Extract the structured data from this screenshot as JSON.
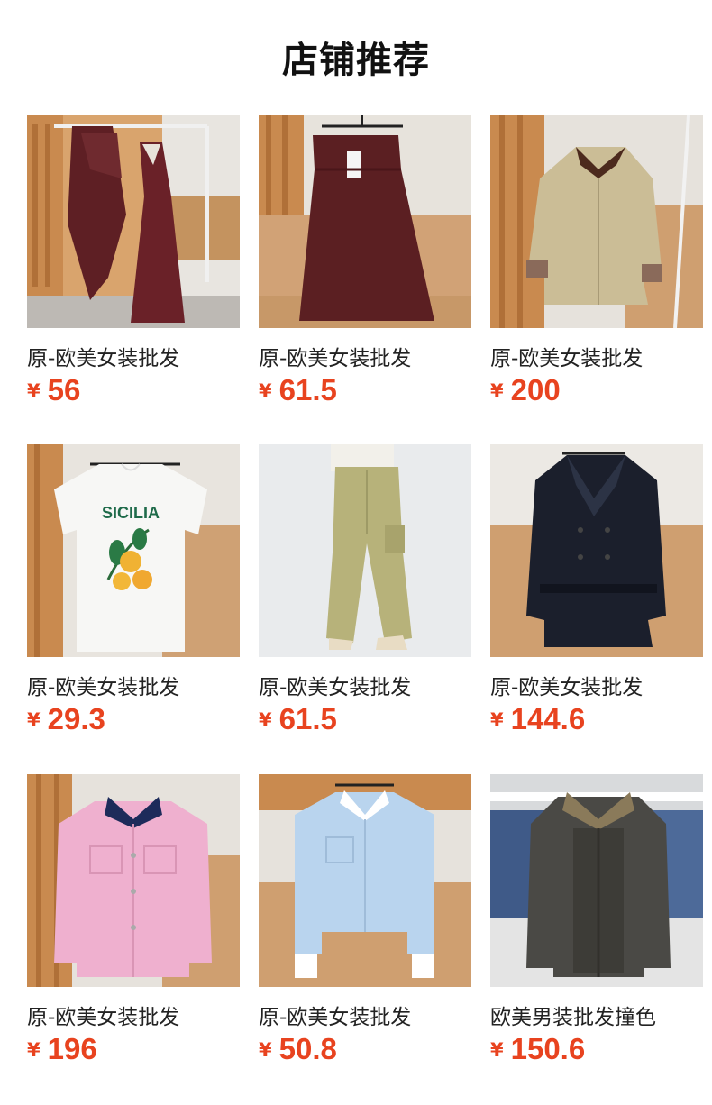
{
  "page_title": "店铺推荐",
  "currency_symbol": "¥",
  "colors": {
    "price": "#e8431f",
    "title": "#111111",
    "name": "#222222"
  },
  "products": [
    {
      "name": "原-欧美女装批发",
      "price": "56",
      "image": "burgundy-satin-slip-dress-and-shawl"
    },
    {
      "name": "原-欧美女装批发",
      "price": "61.5",
      "image": "burgundy-jacquard-wide-pants"
    },
    {
      "name": "原-欧美女装批发",
      "price": "200",
      "image": "beige-trench-jacket-brown-collar"
    },
    {
      "name": "原-欧美女装批发",
      "price": "29.3",
      "image": "white-tshirt-sicilia-lemon-print"
    },
    {
      "name": "原-欧美女装批发",
      "price": "61.5",
      "image": "khaki-cargo-wide-pants"
    },
    {
      "name": "原-欧美女装批发",
      "price": "144.6",
      "image": "navy-belted-trench-coat"
    },
    {
      "name": "原-欧美女装批发",
      "price": "196",
      "image": "pink-denim-jacket-navy-collar"
    },
    {
      "name": "原-欧美女装批发",
      "price": "50.8",
      "image": "light-blue-cropped-shirt"
    },
    {
      "name": "欧美男装批发撞色",
      "price": "150.6",
      "image": "grey-mens-jacket-corduroy-collar"
    }
  ],
  "image_text": {
    "tshirt_print": "SICILIA"
  }
}
